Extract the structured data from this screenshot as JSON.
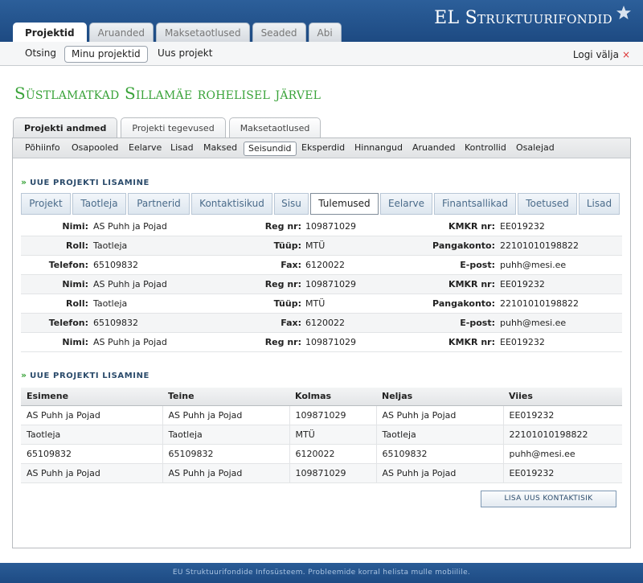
{
  "header": {
    "brand": "EL Struktuurifondid",
    "tabs": [
      "Projektid",
      "Aruanded",
      "Maksetaotlused",
      "Seaded",
      "Abi"
    ]
  },
  "subnav": {
    "items": [
      "Otsing",
      "Minu projektid",
      "Uus projekt"
    ],
    "logout": "Logi välja",
    "logout_icon": "×"
  },
  "page_title": "Süstlamatkad Sillamäe rohelisel järvel",
  "panel_tabs": [
    "Projekti andmed",
    "Projekti tegevused",
    "Maksetaotlused"
  ],
  "subtabs": [
    "Põhiinfo",
    "Osapooled",
    "Eelarve",
    "Lisad",
    "Maksed",
    "Seisundid",
    "Eksperdid",
    "Hinnangud",
    "Aruanded",
    "Kontrollid",
    "Osalejad"
  ],
  "section1_title": "UUE PROJEKTI LISAMINE",
  "form_tabs": [
    "Projekt",
    "Taotleja",
    "Partnerid",
    "Kontaktisikud",
    "Sisu",
    "Tulemused",
    "Eelarve",
    "Finantsallikad",
    "Toetused",
    "Lisad"
  ],
  "detail_rows": [
    [
      [
        "Nimi:",
        "AS Puhh ja Pojad"
      ],
      [
        "Reg nr:",
        "109871029"
      ],
      [
        "KMKR nr:",
        "EE019232"
      ]
    ],
    [
      [
        "Roll:",
        "Taotleja"
      ],
      [
        "Tüüp:",
        "MTÜ"
      ],
      [
        "Pangakonto:",
        "22101010198822"
      ]
    ],
    [
      [
        "Telefon:",
        "65109832"
      ],
      [
        "Fax:",
        "6120022"
      ],
      [
        "E-post:",
        "puhh@mesi.ee"
      ]
    ],
    [
      [
        "Nimi:",
        "AS Puhh ja Pojad"
      ],
      [
        "Reg nr:",
        "109871029"
      ],
      [
        "KMKR nr:",
        "EE019232"
      ]
    ],
    [
      [
        "Roll:",
        "Taotleja"
      ],
      [
        "Tüüp:",
        "MTÜ"
      ],
      [
        "Pangakonto:",
        "22101010198822"
      ]
    ],
    [
      [
        "Telefon:",
        "65109832"
      ],
      [
        "Fax:",
        "6120022"
      ],
      [
        "E-post:",
        "puhh@mesi.ee"
      ]
    ],
    [
      [
        "Nimi:",
        "AS Puhh ja Pojad"
      ],
      [
        "Reg nr:",
        "109871029"
      ],
      [
        "KMKR nr:",
        "EE019232"
      ]
    ]
  ],
  "section2_title": "UUE PROJEKTI LISAMINE",
  "table": {
    "columns": [
      "Esimene",
      "Teine",
      "Kolmas",
      "Neljas",
      "Viies"
    ],
    "rows": [
      [
        "AS Puhh ja Pojad",
        "AS Puhh ja Pojad",
        "109871029",
        "AS Puhh ja Pojad",
        "EE019232"
      ],
      [
        "Taotleja",
        "Taotleja",
        "MTÜ",
        "Taotleja",
        "22101010198822"
      ],
      [
        "65109832",
        "65109832",
        "6120022",
        "65109832",
        "puhh@mesi.ee"
      ],
      [
        "AS Puhh ja Pojad",
        "AS Puhh ja Pojad",
        "109871029",
        "AS Puhh ja Pojad",
        "EE019232"
      ]
    ]
  },
  "add_button": "LISA UUS KONTAKTISIK",
  "footer": "EU Struktuurifondide Infosüsteem. Probleemide korral helista mulle mobiilile."
}
